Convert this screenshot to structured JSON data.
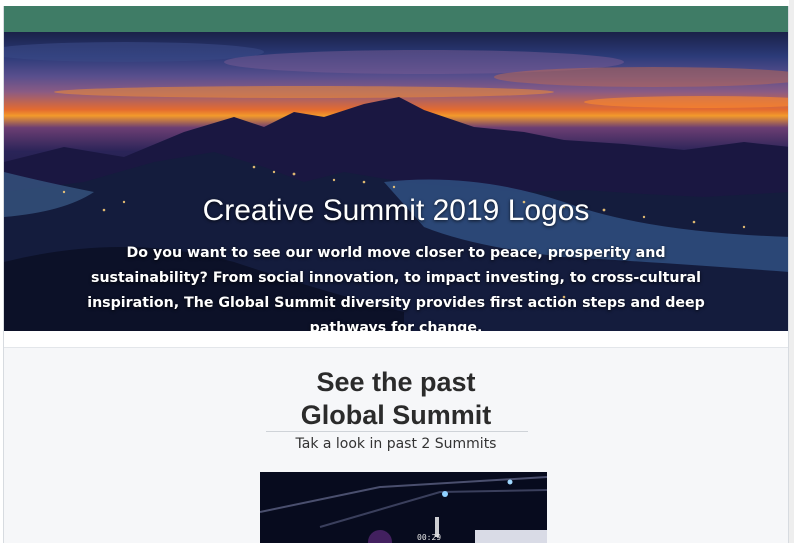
{
  "colors": {
    "topbar": "#3f7c66",
    "page_background": "#f6f7f9",
    "hero_text": "#ffffff",
    "section_text": "#2b2b2b"
  },
  "hero": {
    "title": "Creative Summit 2019 Logos",
    "description": "Do you want to see our world move closer to peace, prosperity and sustainability? From social innovation, to impact investing, to cross-cultural inspiration, The Global Summit diversity provides first action steps and deep pathways for change.",
    "background_image": "city-night-panorama"
  },
  "past_summit": {
    "title_line1": "See the past",
    "title_line2": "Global Summit",
    "subtitle": "Tak a look in past 2 Summits",
    "video": {
      "thumbnail": "conference-stage-photo",
      "timecode": "00:29"
    }
  }
}
